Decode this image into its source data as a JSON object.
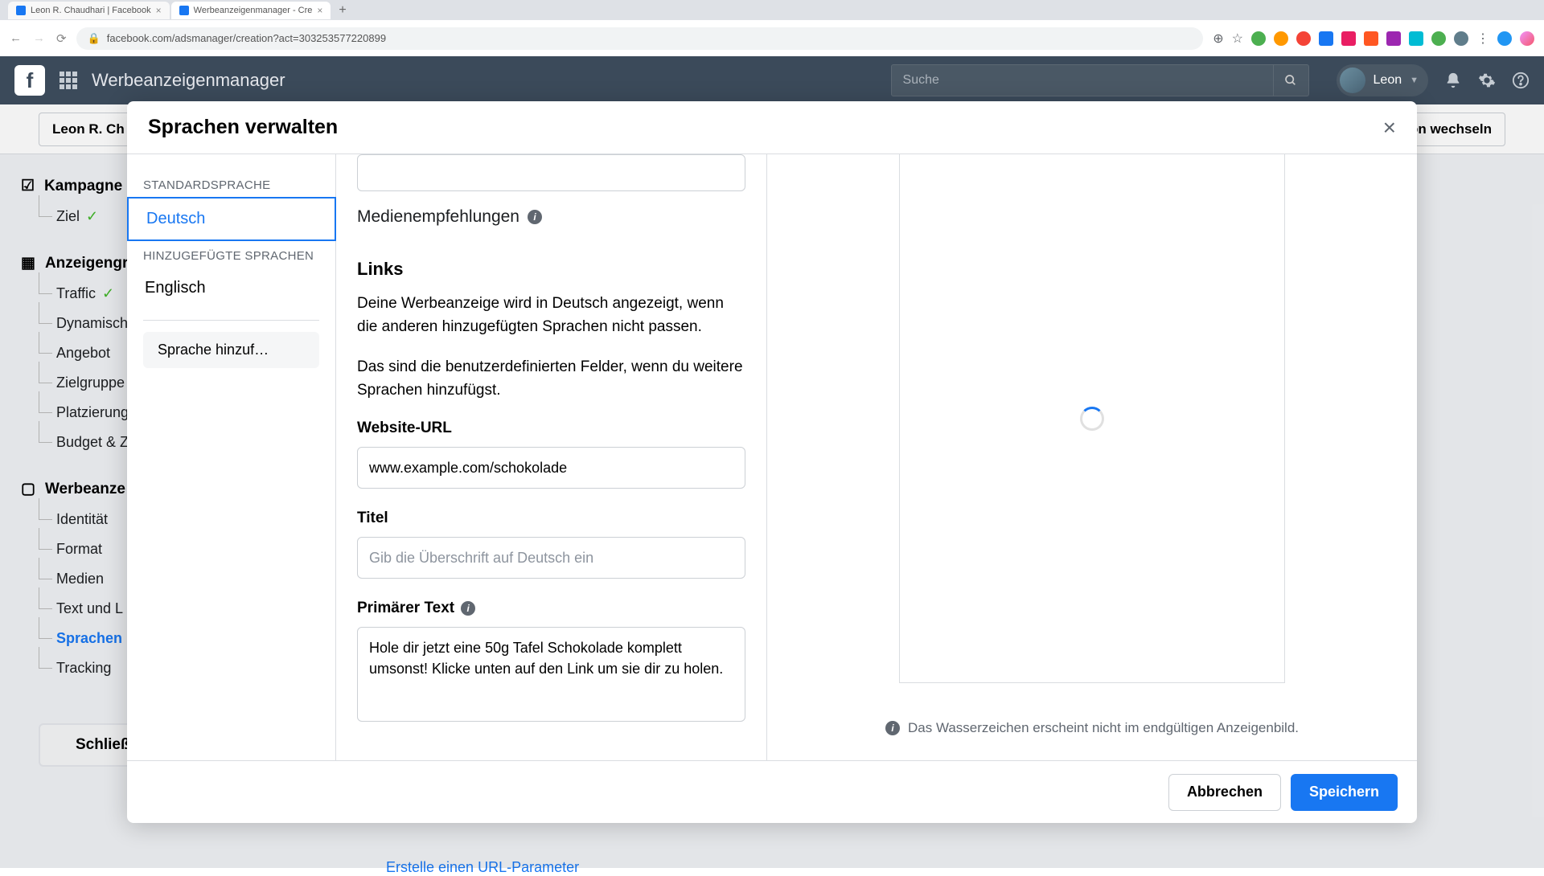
{
  "browser": {
    "tabs": [
      {
        "title": "Leon R. Chaudhari | Facebook"
      },
      {
        "title": "Werbeanzeigenmanager - Cre"
      }
    ],
    "url": "facebook.com/adsmanager/creation?act=303253577220899"
  },
  "header": {
    "app_title": "Werbeanzeigenmanager",
    "search_placeholder": "Suche",
    "user_name": "Leon"
  },
  "account_bar": {
    "account": "Leon R. Ch",
    "switch": "on wechseln"
  },
  "left_nav": {
    "campaign": "Kampagne",
    "campaign_items": [
      "Ziel"
    ],
    "adset": "Anzeigengr",
    "adset_items": [
      "Traffic",
      "Dynamisch",
      "Angebot",
      "Zielgruppe",
      "Platzierung",
      "Budget & Z"
    ],
    "ad": "Werbeanze",
    "ad_items": [
      "Identität",
      "Format",
      "Medien",
      "Text und L",
      "Sprachen",
      "Tracking"
    ],
    "close": "Schließen"
  },
  "modal": {
    "title": "Sprachen verwalten",
    "default_lang_label": "STANDARDSPRACHE",
    "default_lang": "Deutsch",
    "added_label": "HINZUGEFÜGTE SPRACHEN",
    "added_lang": "Englisch",
    "add_lang": "Sprache hinzuf…",
    "media_rec": "Medienempfehlungen",
    "links_heading": "Links",
    "p1": "Deine Werbeanzeige wird in Deutsch angezeigt, wenn die anderen hinzugefügten Sprachen nicht passen.",
    "p2": "Das sind die benutzerdefinierten Felder, wenn du weitere Sprachen hinzufügst.",
    "url_label": "Website-URL",
    "url_value": "www.example.com/schokolade",
    "title_label": "Titel",
    "title_placeholder": "Gib die Überschrift auf Deutsch ein",
    "primary_label": "Primärer Text",
    "primary_value": "Hole dir jetzt eine 50g Tafel Schokolade komplett umsonst! Klicke unten auf den Link um sie dir zu holen.",
    "watermark": "Das Wasserzeichen erscheint nicht im endgültigen Anzeigenbild.",
    "cancel": "Abbrechen",
    "save": "Speichern"
  },
  "bottom_link": "Erstelle einen URL-Parameter"
}
